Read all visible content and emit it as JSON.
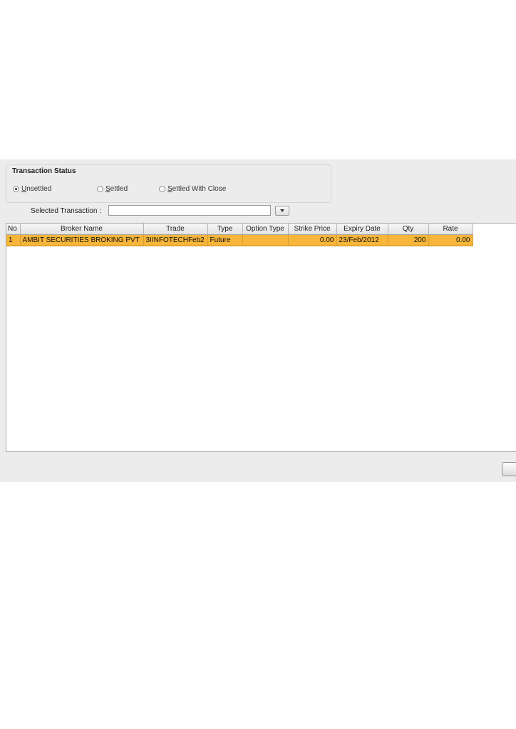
{
  "transaction_status": {
    "title": "Transaction Status",
    "options": [
      {
        "label_mnemonic": "U",
        "label_rest": "nsettled",
        "checked": true
      },
      {
        "label_mnemonic": "S",
        "label_rest": "ettled",
        "checked": false
      },
      {
        "label_mnemonic": "S",
        "label_rest": "ettled With Close",
        "checked": false
      }
    ]
  },
  "selected_transaction": {
    "label": "Selected Transaction :",
    "value": ""
  },
  "table": {
    "columns": [
      "No",
      "Broker Name",
      "Trade",
      "Type",
      "Option Type",
      "Strike Price",
      "Expiry Date",
      "Qty",
      "Rate"
    ],
    "rows": [
      {
        "no": "1",
        "broker_name": "AMBIT SECURITIES BROKING PVT",
        "trade": "3IINFOTECHFeb2",
        "type": "Future",
        "option_type": "",
        "strike_price": "0.00",
        "expiry_date": "23/Feb/2012",
        "qty": "200",
        "rate": "0.00",
        "selected": true
      }
    ]
  },
  "colors": {
    "selection": "#f7b53a",
    "window_bg": "#ececec"
  }
}
